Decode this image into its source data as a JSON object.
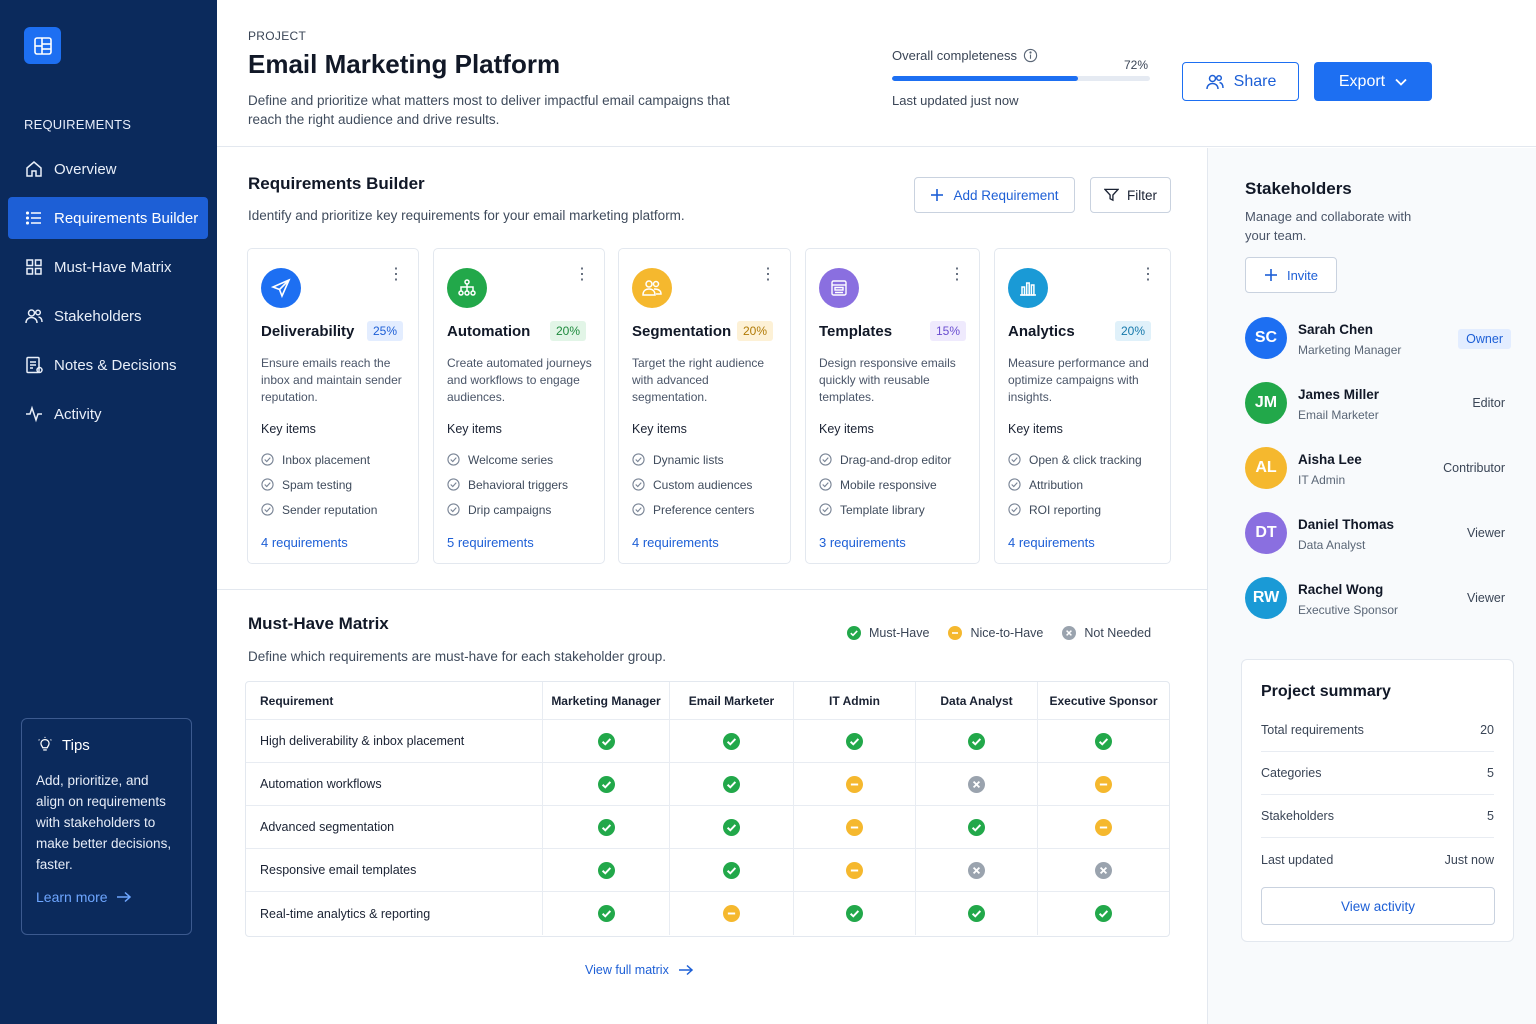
{
  "sidebar": {
    "section_label": "REQUIREMENTS",
    "items": [
      {
        "label": "Overview",
        "icon": "home-icon"
      },
      {
        "label": "Requirements Builder",
        "icon": "list-icon"
      },
      {
        "label": "Must-Have Matrix",
        "icon": "grid-icon"
      },
      {
        "label": "Stakeholders",
        "icon": "users-icon"
      },
      {
        "label": "Notes & Decisions",
        "icon": "notes-icon"
      },
      {
        "label": "Activity",
        "icon": "activity-icon"
      }
    ],
    "tips": {
      "title": "Tips",
      "text": "Add, prioritize, and align on requirements with stakeholders to make better decisions, faster.",
      "link": "Learn more"
    }
  },
  "header": {
    "label": "PROJECT",
    "title": "Email Marketing Platform",
    "description": "Define and prioritize what matters most to deliver impactful email campaigns that reach the right audience and drive results.",
    "completeness_label": "Overall completeness",
    "completeness_pct_text": "72%",
    "completeness_value": 0.72,
    "updated": "Last updated just now",
    "share_label": "Share",
    "export_label": "Export"
  },
  "builder": {
    "title": "Requirements Builder",
    "description": "Identify and prioritize key requirements for your email marketing platform.",
    "add_label": "Add Requirement",
    "filter_label": "Filter",
    "key_items_label": "Key items",
    "cards": [
      {
        "name": "Deliverability",
        "pct": "25%",
        "desc": "Ensure emails reach the inbox and maintain sender reputation.",
        "items": [
          "Inbox placement",
          "Spam testing",
          "Sender reputation"
        ],
        "link": "4 requirements",
        "color": "#1d6ff2",
        "pct_bg": "#e3edff",
        "pct_fg": "#1d5fd6",
        "icon": "send-icon"
      },
      {
        "name": "Automation",
        "pct": "20%",
        "desc": "Create automated journeys and workflows to engage audiences.",
        "items": [
          "Welcome series",
          "Behavioral triggers",
          "Drip campaigns"
        ],
        "link": "5 requirements",
        "color": "#22a84a",
        "pct_bg": "#e2f5e7",
        "pct_fg": "#1e8a3e",
        "icon": "workflow-icon"
      },
      {
        "name": "Segmentation",
        "pct": "20%",
        "desc": "Target the right audience with advanced segmentation.",
        "items": [
          "Dynamic lists",
          "Custom audiences",
          "Preference centers"
        ],
        "link": "4 requirements",
        "color": "#f5b82e",
        "pct_bg": "#fdf1d6",
        "pct_fg": "#b07a06",
        "icon": "audience-icon"
      },
      {
        "name": "Templates",
        "pct": "15%",
        "desc": "Design responsive emails quickly with reusable templates.",
        "items": [
          "Drag-and-drop editor",
          "Mobile responsive",
          "Template library"
        ],
        "link": "3 requirements",
        "color": "#8a6fe0",
        "pct_bg": "#efeafd",
        "pct_fg": "#6a4ed0",
        "icon": "template-icon"
      },
      {
        "name": "Analytics",
        "pct": "20%",
        "desc": "Measure performance and optimize campaigns with insights.",
        "items": [
          "Open & click tracking",
          "Attribution",
          "ROI reporting"
        ],
        "link": "4 requirements",
        "color": "#1a9ad6",
        "pct_bg": "#e0f1fa",
        "pct_fg": "#1679ab",
        "icon": "chart-icon"
      }
    ]
  },
  "matrix": {
    "title": "Must-Have Matrix",
    "description": "Define which requirements are must-have for each stakeholder group.",
    "legend": {
      "must": "Must-Have",
      "nice": "Nice-to-Have",
      "none": "Not Needed"
    },
    "columns": [
      "Requirement",
      "Marketing Manager",
      "Email Marketer",
      "IT Admin",
      "Data Analyst",
      "Executive Sponsor"
    ],
    "rows": [
      {
        "name": "High deliverability & inbox placement",
        "values": [
          "must",
          "must",
          "must",
          "must",
          "must"
        ]
      },
      {
        "name": "Automation workflows",
        "values": [
          "must",
          "must",
          "nice",
          "none",
          "nice"
        ]
      },
      {
        "name": "Advanced segmentation",
        "values": [
          "must",
          "must",
          "nice",
          "must",
          "nice"
        ]
      },
      {
        "name": "Responsive email templates",
        "values": [
          "must",
          "must",
          "nice",
          "none",
          "none"
        ]
      },
      {
        "name": "Real-time analytics & reporting",
        "values": [
          "must",
          "nice",
          "must",
          "must",
          "must"
        ]
      }
    ],
    "view_full": "View full matrix",
    "colors": {
      "must": "#22a84a",
      "nice": "#f5b82e",
      "none": "#9aa3ae"
    }
  },
  "stakeholders": {
    "title": "Stakeholders",
    "description": "Manage and collaborate with your team.",
    "invite_label": "Invite",
    "people": [
      {
        "initials": "SC",
        "name": "Sarah Chen",
        "role": "Marketing Manager",
        "perm": "Owner",
        "color": "#1d6ff2"
      },
      {
        "initials": "JM",
        "name": "James Miller",
        "role": "Email Marketer",
        "perm": "Editor",
        "color": "#22a84a"
      },
      {
        "initials": "AL",
        "name": "Aisha Lee",
        "role": "IT Admin",
        "perm": "Contributor",
        "color": "#f5b82e"
      },
      {
        "initials": "DT",
        "name": "Daniel Thomas",
        "role": "Data Analyst",
        "perm": "Viewer",
        "color": "#8a6fe0"
      },
      {
        "initials": "RW",
        "name": "Rachel Wong",
        "role": "Executive Sponsor",
        "perm": "Viewer",
        "color": "#1a9ad6"
      }
    ]
  },
  "summary": {
    "title": "Project summary",
    "rows": [
      {
        "label": "Total requirements",
        "value": "20"
      },
      {
        "label": "Categories",
        "value": "5"
      },
      {
        "label": "Stakeholders",
        "value": "5"
      },
      {
        "label": "Last updated",
        "value": "Just now"
      }
    ],
    "button": "View activity"
  }
}
